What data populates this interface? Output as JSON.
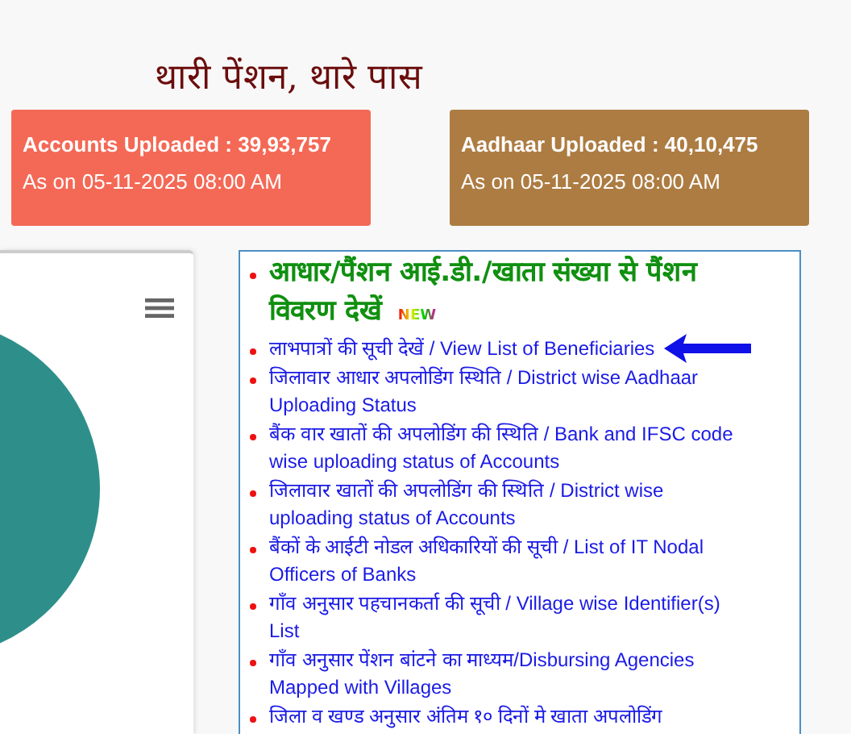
{
  "title": "थारी पेंशन, थारे पास",
  "stat_cards": [
    {
      "heading": "Accounts Uploaded : 39,93,757",
      "subtitle": "As on 05-11-2025 08:00 AM",
      "color": "#f46956"
    },
    {
      "heading": "Aadhaar Uploaded : 40,10,475",
      "subtitle": "As on 05-11-2025 08:00 AM",
      "color": "#ad7c42"
    }
  ],
  "links_panel": {
    "headline": "आधार/पैंशन आई.डी./खाता संख्या से पैंशन विवरण देखें",
    "badge": "NEW",
    "links": [
      {
        "text": "लाभपात्रों की सूची देखें / View List of Beneficiaries",
        "highlighted": true
      },
      {
        "text": "जिलावार आधार अपलोडिंग स्थिति / District wise Aadhaar Uploading Status",
        "highlighted": false
      },
      {
        "text": "बैंक वार खातों की अपलोडिंग की स्थिति / Bank and IFSC code wise uploading status of Accounts",
        "highlighted": false
      },
      {
        "text": "जिलावार खातों की अपलोडिंग की स्थिति / District wise uploading status of Accounts",
        "highlighted": false
      },
      {
        "text": "बैंकों के आईटी नोडल अधिकारियों की सूची / List of IT Nodal Officers of Banks",
        "highlighted": false
      },
      {
        "text": "गाँव अनुसार पहचानकर्ता की सूची / Village wise Identifier(s) List",
        "highlighted": false
      },
      {
        "text": "गाँव अनुसार पेंशन बांटने का माध्यम/Disbursing Agencies Mapped with Villages",
        "highlighted": false
      },
      {
        "text": "जिला व खण्ड अनुसार अंतिम १० दिनों मे खाता अपलोडिंग",
        "highlighted": false
      }
    ]
  }
}
